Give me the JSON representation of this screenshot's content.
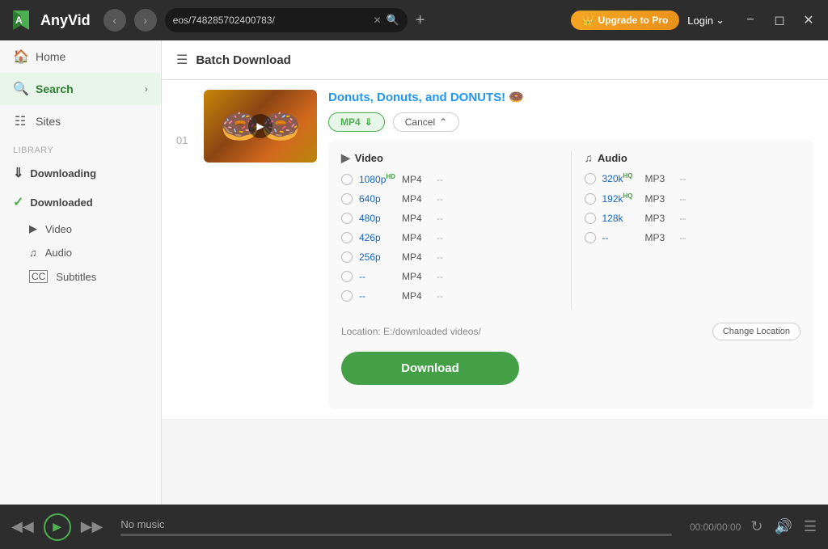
{
  "app": {
    "name": "AnyVid",
    "logo_letter": "A"
  },
  "titlebar": {
    "url": "eos/748285702400783/",
    "upgrade_label": "Upgrade to Pro",
    "login_label": "Login"
  },
  "sidebar": {
    "home_label": "Home",
    "search_label": "Search",
    "sites_label": "Sites",
    "library_label": "Library",
    "downloading_label": "Downloading",
    "downloaded_label": "Downloaded",
    "video_label": "Video",
    "audio_label": "Audio",
    "subtitles_label": "Subtitles"
  },
  "batch_header": {
    "title": "Batch Download"
  },
  "video_item": {
    "number": "01",
    "title": "Donuts, Donuts, and DONUTS! 🍩",
    "mp4_label": "MP4",
    "cancel_label": "Cancel"
  },
  "format_panel": {
    "video_header": "Video",
    "audio_header": "Audio",
    "video_options": [
      {
        "res": "1080p",
        "badge": "HD",
        "fmt": "MP4",
        "size": "--"
      },
      {
        "res": "640p",
        "badge": "",
        "fmt": "MP4",
        "size": "--"
      },
      {
        "res": "480p",
        "badge": "",
        "fmt": "MP4",
        "size": "--"
      },
      {
        "res": "426p",
        "badge": "",
        "fmt": "MP4",
        "size": "--"
      },
      {
        "res": "256p",
        "badge": "",
        "fmt": "MP4",
        "size": "--"
      },
      {
        "res": "--",
        "badge": "",
        "fmt": "MP4",
        "size": "--"
      },
      {
        "res": "--",
        "badge": "",
        "fmt": "MP4",
        "size": "--"
      }
    ],
    "audio_options": [
      {
        "res": "320k",
        "badge": "HQ",
        "fmt": "MP3",
        "size": "--"
      },
      {
        "res": "192k",
        "badge": "HQ",
        "fmt": "MP3",
        "size": "--"
      },
      {
        "res": "128k",
        "badge": "",
        "fmt": "MP3",
        "size": "--"
      },
      {
        "res": "--",
        "badge": "",
        "fmt": "MP3",
        "size": "--"
      }
    ]
  },
  "location": {
    "path": "Location: E:/downloaded videos/",
    "change_label": "Change Location"
  },
  "download_button": {
    "label": "Download"
  },
  "bottom_bar": {
    "no_music": "No music",
    "time": "00:00/00:00"
  }
}
